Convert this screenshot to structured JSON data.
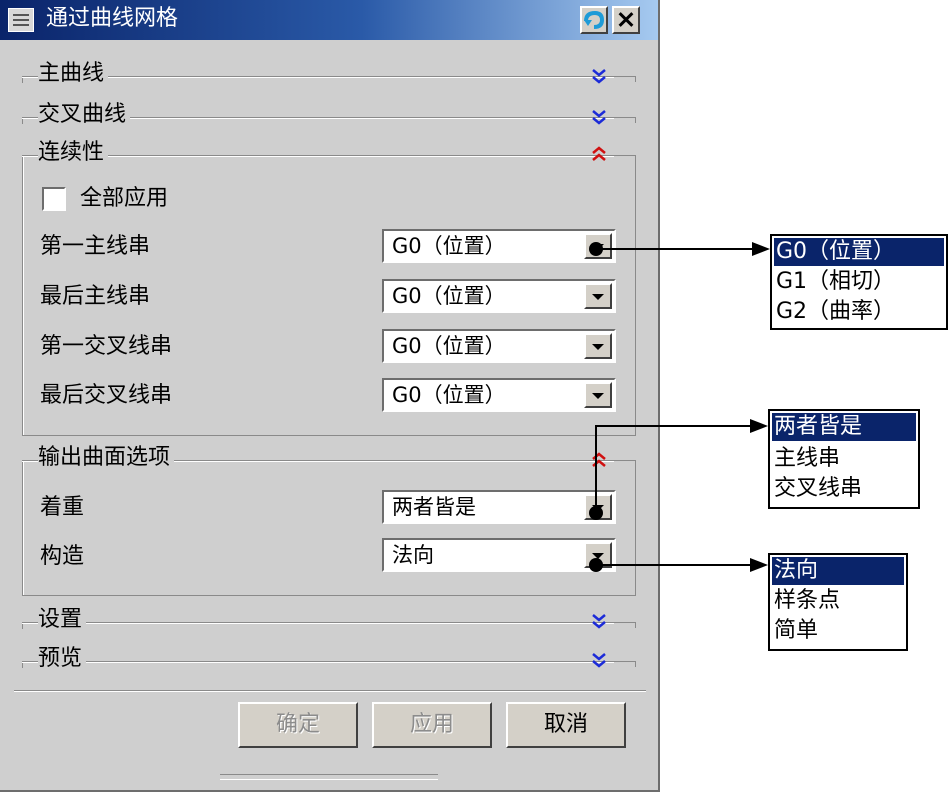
{
  "title": "通过曲线网格",
  "sections": {
    "primary_curves": "主曲线",
    "cross_curves": "交叉曲线",
    "continuity": "连续性",
    "output_options": "输出曲面选项",
    "settings": "设置",
    "preview": "预览"
  },
  "continuity": {
    "apply_all_label": "全部应用",
    "apply_all_checked": false,
    "rows": [
      {
        "label": "第一主线串",
        "value": "G0（位置）"
      },
      {
        "label": "最后主线串",
        "value": "G0（位置）"
      },
      {
        "label": "第一交叉线串",
        "value": "G0（位置）"
      },
      {
        "label": "最后交叉线串",
        "value": "G0（位置）"
      }
    ]
  },
  "output": {
    "emphasis_label": "着重",
    "emphasis_value": "两者皆是",
    "construction_label": "构造",
    "construction_value": "法向"
  },
  "buttons": {
    "ok": "确定",
    "apply": "应用",
    "cancel": "取消"
  },
  "dropdown_continuity": [
    "G0（位置）",
    "G1（相切）",
    "G2（曲率）"
  ],
  "dropdown_emphasis": [
    "两者皆是",
    "主线串",
    "交叉线串"
  ],
  "dropdown_construction": [
    "法向",
    "样条点",
    "简单"
  ],
  "colors": {
    "title_bar": "#0a246a",
    "selection": "#0a246a",
    "expand_chevron": "#1c2bd8",
    "collapse_chevron": "#d01010"
  },
  "icons": [
    "menu-icon",
    "back-icon",
    "close-icon",
    "chevron-down-icon",
    "chevron-up-icon"
  ]
}
